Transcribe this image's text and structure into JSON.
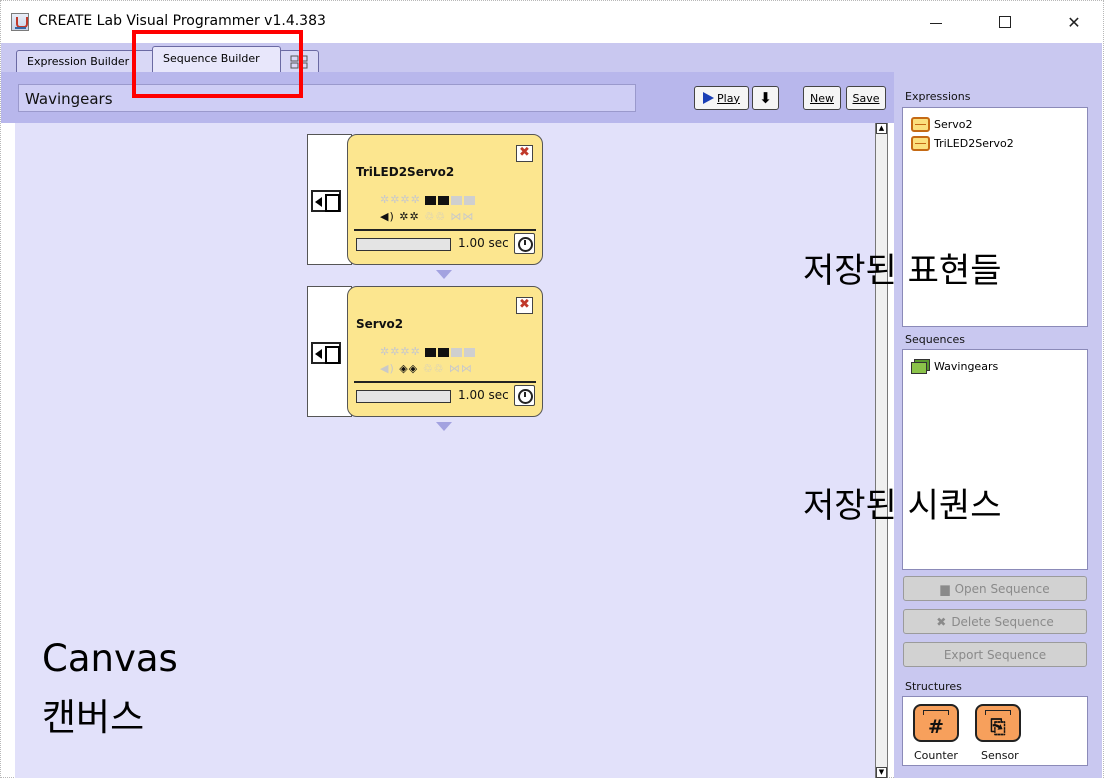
{
  "window": {
    "title": "CREATE Lab Visual Programmer v1.4.383",
    "controls": {
      "minimize": "",
      "maximize": "",
      "close": "✕"
    }
  },
  "tabs": [
    {
      "label": "Expression Builder",
      "active": false
    },
    {
      "label": "Sequence Builder",
      "active": true
    },
    {
      "label": "",
      "active": false
    }
  ],
  "toolbar": {
    "sequence_name": "Wavingears",
    "play_label": "Play",
    "down_label": "⬇",
    "new_label": "New",
    "save_label": "Save"
  },
  "canvas": {
    "cards": [
      {
        "title": "TriLED2Servo2",
        "close": "✖",
        "duration": "1.00 sec",
        "icons_top": "✲✲✲✲",
        "icons_bottom_a": "◀)",
        "icons_bottom_b": "✲✲",
        "icons_bottom_c": "♲♲ ⋈⋈"
      },
      {
        "title": "Servo2",
        "close": "✖",
        "duration": "1.00 sec",
        "icons_top": "✲✲✲✲",
        "icons_bottom_a": "◀)",
        "icons_bottom_b": "◈◈",
        "icons_bottom_c": "♲♲ ⋈⋈"
      }
    ],
    "label_en": "Canvas",
    "label_ko": "캔버스"
  },
  "expressions": {
    "label": "Expressions",
    "items": [
      "Servo2",
      "TriLED2Servo2"
    ],
    "annotation": "저장된 표현들"
  },
  "sequences": {
    "label": "Sequences",
    "items": [
      "Wavingears"
    ],
    "annotation": "저장된 시퀀스"
  },
  "sequence_buttons": {
    "open": "Open Sequence",
    "delete": "Delete Sequence",
    "export": "Export Sequence"
  },
  "structures": {
    "label": "Structures",
    "counter": "Counter",
    "sensor": "Sensor",
    "counter_glyph": "#",
    "sensor_glyph": "⎘"
  },
  "colors": {
    "tab_strip": "#c9c8f0",
    "canvas": "#e2e1fa",
    "card": "#fce68f",
    "highlight": "#ff0000",
    "structure_button": "#f7a05c"
  }
}
